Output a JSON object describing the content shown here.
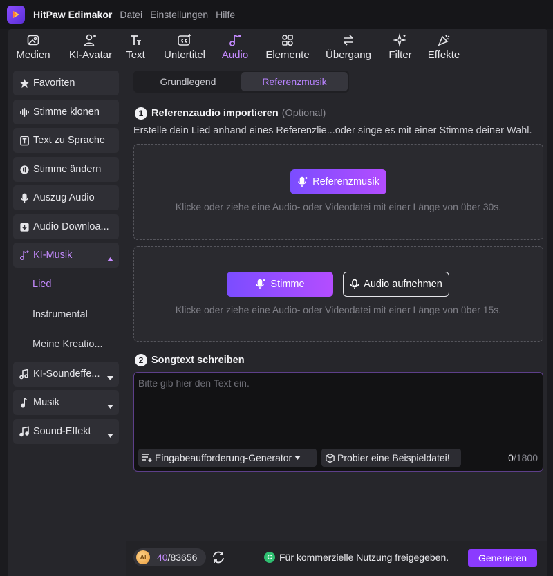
{
  "app": {
    "name": "HitPaw Edimakor",
    "menu": [
      "Datei",
      "Einstellungen",
      "Hilfe"
    ]
  },
  "toolbar": {
    "items": [
      {
        "label": "Medien",
        "icon": "media-icon"
      },
      {
        "label": "KI-Avatar",
        "icon": "avatar-icon"
      },
      {
        "label": "Text",
        "icon": "text-icon"
      },
      {
        "label": "Untertitel",
        "icon": "subtitle-icon"
      },
      {
        "label": "Audio",
        "icon": "audio-icon",
        "active": true
      },
      {
        "label": "Elemente",
        "icon": "elements-icon"
      },
      {
        "label": "Übergang",
        "icon": "transition-icon"
      },
      {
        "label": "Filter",
        "icon": "filter-icon"
      },
      {
        "label": "Effekte",
        "icon": "effects-icon"
      }
    ]
  },
  "sidebar": {
    "items": [
      {
        "label": "Favoriten",
        "icon": "star-icon"
      },
      {
        "label": "Stimme klonen",
        "icon": "waveform-icon"
      },
      {
        "label": "Text zu Sprache",
        "icon": "text-speech-icon"
      },
      {
        "label": "Stimme ändern",
        "icon": "voice-change-icon"
      },
      {
        "label": "Auszug Audio",
        "icon": "microphone-icon"
      },
      {
        "label": "Audio Downloa...",
        "icon": "download-icon"
      },
      {
        "label": "KI-Musik",
        "icon": "ai-music-icon",
        "active": true,
        "expanded": true
      }
    ],
    "subitems": [
      {
        "label": "Lied",
        "active": true
      },
      {
        "label": "Instrumental"
      },
      {
        "label": "Meine Kreatio..."
      }
    ],
    "items_after": [
      {
        "label": "KI-Soundeffe...",
        "icon": "sound-fx-icon"
      },
      {
        "label": "Musik",
        "icon": "music-note-icon"
      },
      {
        "label": "Sound-Effekt",
        "icon": "sound-effect-icon"
      }
    ]
  },
  "tabs": [
    {
      "label": "Grundlegend"
    },
    {
      "label": "Referenzmusik",
      "active": true
    }
  ],
  "step1": {
    "number": "1",
    "title": "Referenzaudio importieren",
    "optional": "(Optional)",
    "description": "Erstelle dein Lied anhand eines Referenzlie...oder singe es mit einer Stimme deiner Wahl."
  },
  "dropzone1": {
    "button": "Referenzmusik",
    "hint": "Klicke oder ziehe eine Audio- oder Videodatei mit einer Länge von über 30s."
  },
  "dropzone2": {
    "button_voice": "Stimme",
    "button_record": "Audio aufnehmen",
    "hint": "Klicke oder ziehe eine Audio- oder Videodatei mit einer Länge von über 15s."
  },
  "step2": {
    "number": "2",
    "title": "Songtext schreiben"
  },
  "lyrics": {
    "placeholder": "Bitte gib hier den Text ein.",
    "value": "",
    "prompt_generator": "Eingabeaufforderung-Generator",
    "sample": "Probier eine Beispieldatei!",
    "count_current": "0",
    "count_max": "/1800"
  },
  "footer": {
    "coin_label": "AI",
    "credits_used": "40",
    "credits_total": "/83656",
    "commercial_badge": "C",
    "commercial_text": "Für kommerzielle Nutzung freigegeben.",
    "generate": "Generieren"
  },
  "colors": {
    "accent": "#c58bff",
    "gradient_start": "#7b4dff",
    "gradient_end": "#b44dff",
    "generate_button": "#8b3bff",
    "commercial_green": "#2fbf71"
  }
}
